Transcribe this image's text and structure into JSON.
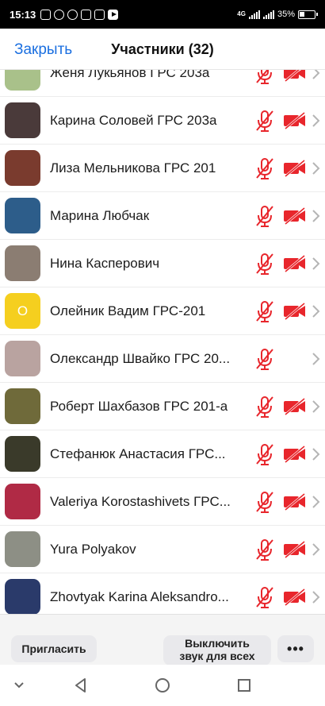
{
  "status_bar": {
    "time": "15:13",
    "network": "4G",
    "battery": "35%"
  },
  "header": {
    "close_label": "Закрыть",
    "title": "Участники (32)"
  },
  "participants": [
    {
      "name": "Женя Лукьянов ГРС 203а",
      "avatar_color": "#a9c18a",
      "initial": "",
      "mic_muted": true,
      "video_off": true
    },
    {
      "name": "Карина Соловей  ГРС 203а",
      "avatar_color": "#4a3a3a",
      "initial": "",
      "mic_muted": true,
      "video_off": true
    },
    {
      "name": "Лиза Мельникова ГРС 201",
      "avatar_color": "#7a3b2e",
      "initial": "",
      "mic_muted": true,
      "video_off": true
    },
    {
      "name": "Марина Любчак",
      "avatar_color": "#2d5d8a",
      "initial": "",
      "mic_muted": true,
      "video_off": true
    },
    {
      "name": "Нина Касперович",
      "avatar_color": "#8b7d72",
      "initial": "",
      "mic_muted": true,
      "video_off": true
    },
    {
      "name": "Олейник Вадим ГРС-201",
      "avatar_color": "#f5cf1f",
      "initial": "О",
      "mic_muted": true,
      "video_off": true
    },
    {
      "name": "Олександр Швайко ГРС 20...",
      "avatar_color": "#b9a3a0",
      "initial": "",
      "mic_muted": true,
      "video_off": false
    },
    {
      "name": "Роберт Шахбазов ГРС 201-а",
      "avatar_color": "#6f6a3a",
      "initial": "",
      "mic_muted": true,
      "video_off": true
    },
    {
      "name": "Стефанюк Анастасия ГРС...",
      "avatar_color": "#3a3a2a",
      "initial": "",
      "mic_muted": true,
      "video_off": true
    },
    {
      "name": "Valeriya Korostashivets ГРС...",
      "avatar_color": "#b02a45",
      "initial": "",
      "mic_muted": true,
      "video_off": true
    },
    {
      "name": "Yura Polyakov",
      "avatar_color": "#8d8f85",
      "initial": "",
      "mic_muted": true,
      "video_off": true
    },
    {
      "name": "Zhovtyak Karina Aleksandro...",
      "avatar_color": "#2a3a6a",
      "initial": "",
      "mic_muted": true,
      "video_off": true
    }
  ],
  "bottom_bar": {
    "invite_label": "Пригласить",
    "mute_all_line1": "Выключить",
    "mute_all_line2": "звук для всех",
    "more_label": "•••"
  },
  "colors": {
    "accent": "#1b6fe0",
    "muted_red": "#e8262c"
  }
}
